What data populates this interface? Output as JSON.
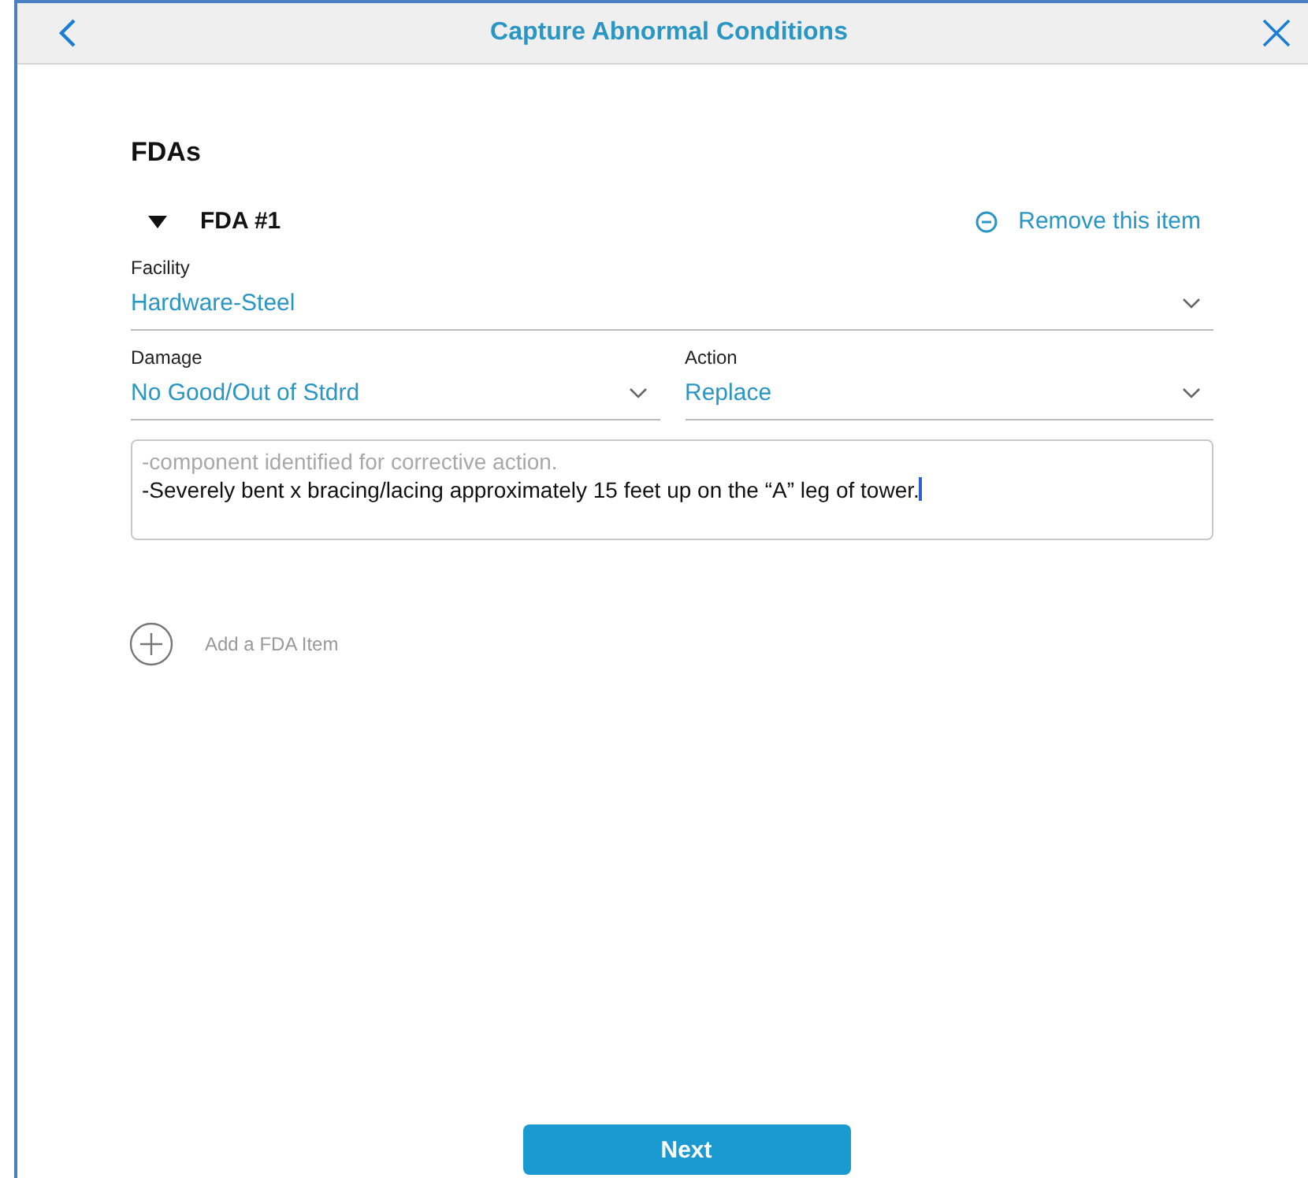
{
  "header": {
    "title": "Capture Abnormal Conditions"
  },
  "section": {
    "title": "FDAs"
  },
  "items": [
    {
      "title": "FDA #1",
      "expanded": true,
      "remove_label": "Remove this item",
      "fields": [
        {
          "label": "Facility",
          "value": "Hardware-Steel",
          "kind": "wide"
        },
        {
          "label": "Damage",
          "value": "No Good/Out of Stdrd",
          "kind": "narrow"
        },
        {
          "label": "Action",
          "value": "Replace",
          "kind": "narrow"
        }
      ],
      "notes": {
        "first_line": "-component identified for corrective action.",
        "text": "-Severely bent x bracing/lacing approximately 15 feet up on the “A” leg of tower."
      }
    }
  ],
  "add_label": "Add a FDA Item",
  "next_button": "Next"
}
